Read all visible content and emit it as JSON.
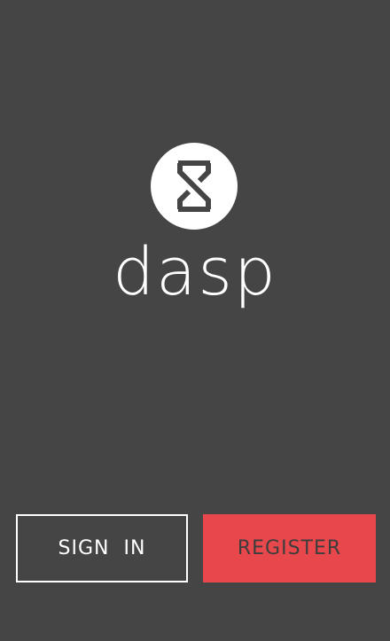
{
  "brand": {
    "logo_icon": "hourglass-icon",
    "name": "dasp"
  },
  "actions": {
    "sign_in_label": "SIGN  IN",
    "register_label": "REGISTER"
  },
  "colors": {
    "background": "#454545",
    "accent": "#e8484c",
    "foreground": "#ffffff"
  }
}
